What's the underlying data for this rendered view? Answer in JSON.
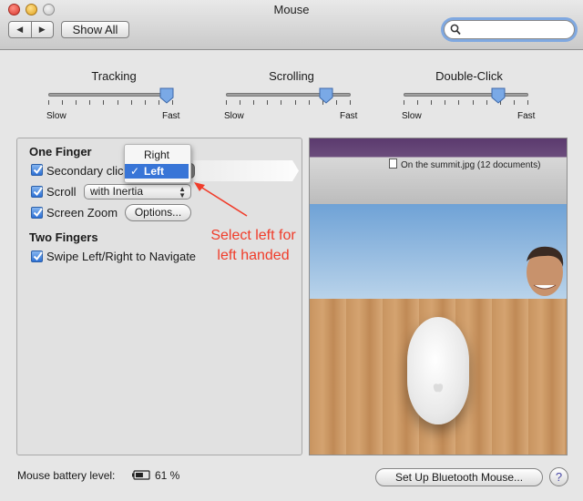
{
  "window": {
    "title": "Mouse"
  },
  "toolbar": {
    "back_glyph": "◀",
    "forward_glyph": "▶",
    "show_all_label": "Show All",
    "search_value": "",
    "search_placeholder": ""
  },
  "sliders": [
    {
      "label": "Tracking",
      "min_label": "Slow",
      "max_label": "Fast",
      "value": 0.95
    },
    {
      "label": "Scrolling",
      "min_label": "Slow",
      "max_label": "Fast",
      "value": 0.8
    },
    {
      "label": "Double-Click",
      "min_label": "Slow",
      "max_label": "Fast",
      "value": 0.76
    }
  ],
  "one_finger": {
    "header": "One Finger",
    "secondary_click": {
      "label": "Secondary clic",
      "checked": true,
      "popup_value": "Left"
    },
    "scroll": {
      "label": "Scroll",
      "checked": true,
      "popup_value": "with Inertia"
    },
    "screen_zoom": {
      "label": "Screen Zoom",
      "checked": true,
      "options_label": "Options..."
    }
  },
  "popup_menu": {
    "options": [
      "Right",
      "Left"
    ],
    "selected": "Left",
    "check": "✓"
  },
  "two_fingers": {
    "header": "Two Fingers",
    "swipe": {
      "label": "Swipe Left/Right to Navigate",
      "checked": true
    }
  },
  "annotation": {
    "text_line1": "Select left for",
    "text_line2": "left handed",
    "color": "#f03c2a"
  },
  "preview": {
    "filename": "On the summit.jpg (12 documents)"
  },
  "footer": {
    "battery_label": "Mouse battery level:",
    "battery_percent": "61 %",
    "battery_level": 0.61,
    "setup_button": "Set Up Bluetooth Mouse...",
    "help_label": "?"
  },
  "colors": {
    "accent": "#3875d7",
    "checkbox": "#2c6fd4"
  }
}
